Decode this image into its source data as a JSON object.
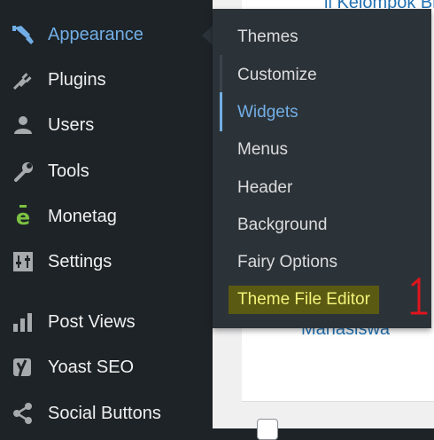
{
  "content_bg": {
    "top_text": "il Kelompok Bi",
    "mid_text": "Mahasiswa"
  },
  "menu": {
    "items": [
      {
        "label": "Appearance",
        "icon": "paintbrush-icon",
        "current": true
      },
      {
        "label": "Plugins",
        "icon": "plug-icon"
      },
      {
        "label": "Users",
        "icon": "user-icon"
      },
      {
        "label": "Tools",
        "icon": "wrench-icon"
      },
      {
        "label": "Monetag",
        "icon": "monetag-e-icon"
      },
      {
        "label": "Settings",
        "icon": "sliders-icon"
      },
      {
        "label": "Post Views",
        "icon": "bar-chart-icon"
      },
      {
        "label": "Yoast SEO",
        "icon": "yoast-icon"
      },
      {
        "label": "Social Buttons",
        "icon": "share-icon"
      }
    ]
  },
  "submenu": {
    "items": [
      {
        "label": "Themes"
      },
      {
        "label": "Customize"
      },
      {
        "label": "Widgets",
        "current": true
      },
      {
        "label": "Menus"
      },
      {
        "label": "Header"
      },
      {
        "label": "Background"
      },
      {
        "label": "Fairy Options"
      },
      {
        "label": "Theme File Editor",
        "highlighted": true
      }
    ]
  },
  "annotation": {
    "mark": "1",
    "color": "#e0141e"
  },
  "colors": {
    "menu_bg": "#1d2327",
    "submenu_bg": "#2c3338",
    "accent": "#72aee6",
    "highlight_bg": "#5a5a12",
    "highlight_text": "#f3f37a",
    "monetag_green": "#7cc242"
  }
}
